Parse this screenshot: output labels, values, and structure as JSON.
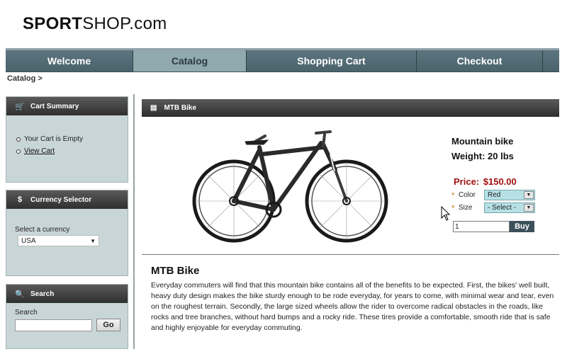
{
  "logo": {
    "bold": "SPORT",
    "rest": "SHOP.com"
  },
  "nav": {
    "tabs": [
      {
        "label": "Welcome"
      },
      {
        "label": "Catalog"
      },
      {
        "label": "Shopping Cart"
      },
      {
        "label": "Checkout"
      }
    ],
    "active": "Catalog"
  },
  "breadcrumb": "Catalog >",
  "cart_summary": {
    "title": "Cart Summary",
    "icon": "cart-icon",
    "items": [
      "Your Cart is Empty",
      "View Cart"
    ]
  },
  "currency": {
    "title": "Currency Selector",
    "icon": "currency-icon",
    "label": "Select a currency",
    "selected": "USA"
  },
  "search": {
    "title": "Search",
    "icon": "magnifier-icon",
    "label": "Search",
    "value": "",
    "button": "Go"
  },
  "product_panel": {
    "title": "MTB Bike",
    "icon": "document-icon"
  },
  "product": {
    "name": "Mountain bike",
    "weight": "Weight: 20 lbs",
    "price_label": "Price:",
    "price_value": "$150.00",
    "color_label": "Color",
    "color_value": "Red",
    "size_label": "Size",
    "size_value": "- Select -",
    "quantity": "1",
    "buy_label": "Buy"
  },
  "description": {
    "title": "MTB Bike",
    "text": "Everyday commuters will find that this mountain bike contains all of the benefits to be expected. First, the bikes' well built, heavy duty design makes the bike sturdy enough to be rode everyday, for years to come, with minimal wear and tear, even on the roughest terrain. Secondly, the large sized wheels allow the rider to overcome radical obstacles in the roads, like rocks and tree branches, without hard bumps and a rocky ride. These tires provide a comfortable, smooth ride that is safe and highly enjoyable for everyday commuting."
  },
  "colors": {
    "nav_bg": "#4f6670",
    "nav_active": "#8fa9ad",
    "panel_bg": "#c9d6d8",
    "price": "#a01010",
    "buy_button": "#3b5059"
  }
}
